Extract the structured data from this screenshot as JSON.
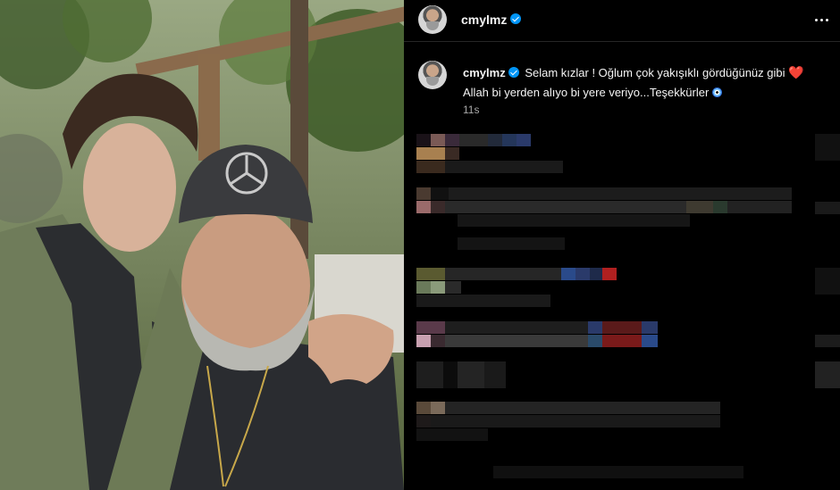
{
  "colors": {
    "background": "#000000",
    "text": "#f5f5f5",
    "muted": "#a8a8a8",
    "verified": "#0095f6",
    "heart": "#e02c3d"
  },
  "post_image": {
    "icon": "photo"
  },
  "header": {
    "username": "cmylmz",
    "verified_icon": "verified-badge-icon",
    "more_icon": "more-horizontal-icon"
  },
  "caption": {
    "username": "cmylmz",
    "text_line1": "Selam kızlar ! Oğlum çok yakışıklı gördüğünüz gibi",
    "text_line2": "Allah bi yerden alıyo bi yere veriyo...Teşekkürler",
    "emoji1": "❤️",
    "emoji2_icon": "evil-eye-icon",
    "time": "11s"
  },
  "comments": {
    "state": "pixelated"
  }
}
